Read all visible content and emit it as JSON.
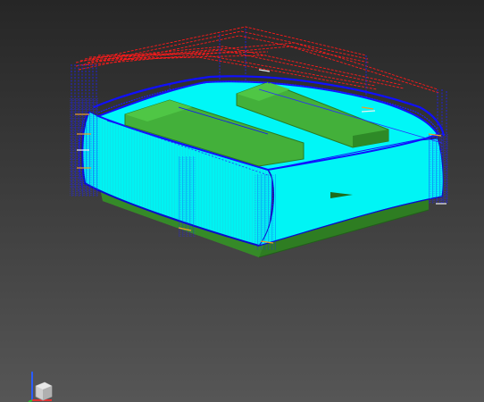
{
  "viewport": {
    "background_top": "#262626",
    "background_bottom": "#565656"
  },
  "colors": {
    "part_top": "#00f7f7",
    "part_side": "#00e0e6",
    "base_green": "#3f9f2f",
    "base_green_dark": "#2e7d22",
    "boss_green": "#43b03a",
    "toolpath_red": "#ff1a1a",
    "toolpath_blue": "#1010ff",
    "toolpath_blue_dark": "#0a0acc",
    "toolpath_orange": "#f0a020",
    "toolpath_white": "#f0f0f0"
  },
  "icons": {
    "triad": "view-orientation-cube-icon"
  }
}
